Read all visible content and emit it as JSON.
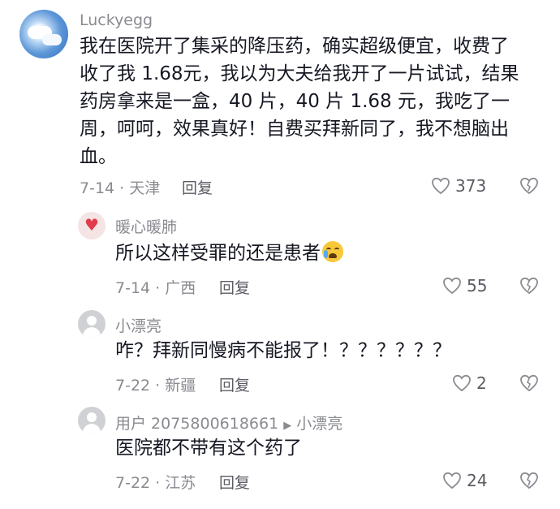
{
  "comments": [
    {
      "username": "Luckyegg",
      "text_lines": [
        "我在医院开了集采的降压药，确实超级便宜，收费了",
        "收了我 1.68元，我以为大夫给我开了一片试试，结果",
        "药房拿来是一盒，40 片，40 片 1.68 元，我吃了一",
        "周，呵呵，效果真好！自费买拜新同了，我不想脑出",
        "血。"
      ],
      "date": "7-14",
      "location": "天津",
      "reply_label": "回复",
      "likes": "373"
    },
    {
      "username": "暖心暖肺",
      "text": "所以这样受罪的还是患者",
      "emoji": "loudly-crying-face",
      "date": "7-14",
      "location": "广西",
      "reply_label": "回复",
      "likes": "55"
    },
    {
      "username": "小漂亮",
      "text": "咋？拜新同慢病不能报了！？？？？？？",
      "date": "7-22",
      "location": "新疆",
      "reply_label": "回复",
      "likes": "2"
    },
    {
      "username": "用户 2075800618661",
      "reply_to": "小漂亮",
      "text": "医院都不带有这个药了",
      "date": "7-22",
      "location": "江苏",
      "reply_label": "回复",
      "likes": "24"
    }
  ],
  "icons": {
    "like": "heart-outline-icon",
    "dislike": "broken-heart-icon",
    "reply_arrow": "play-triangle-icon"
  },
  "colors": {
    "text": "#161823",
    "secondary": "#8a8b91"
  }
}
